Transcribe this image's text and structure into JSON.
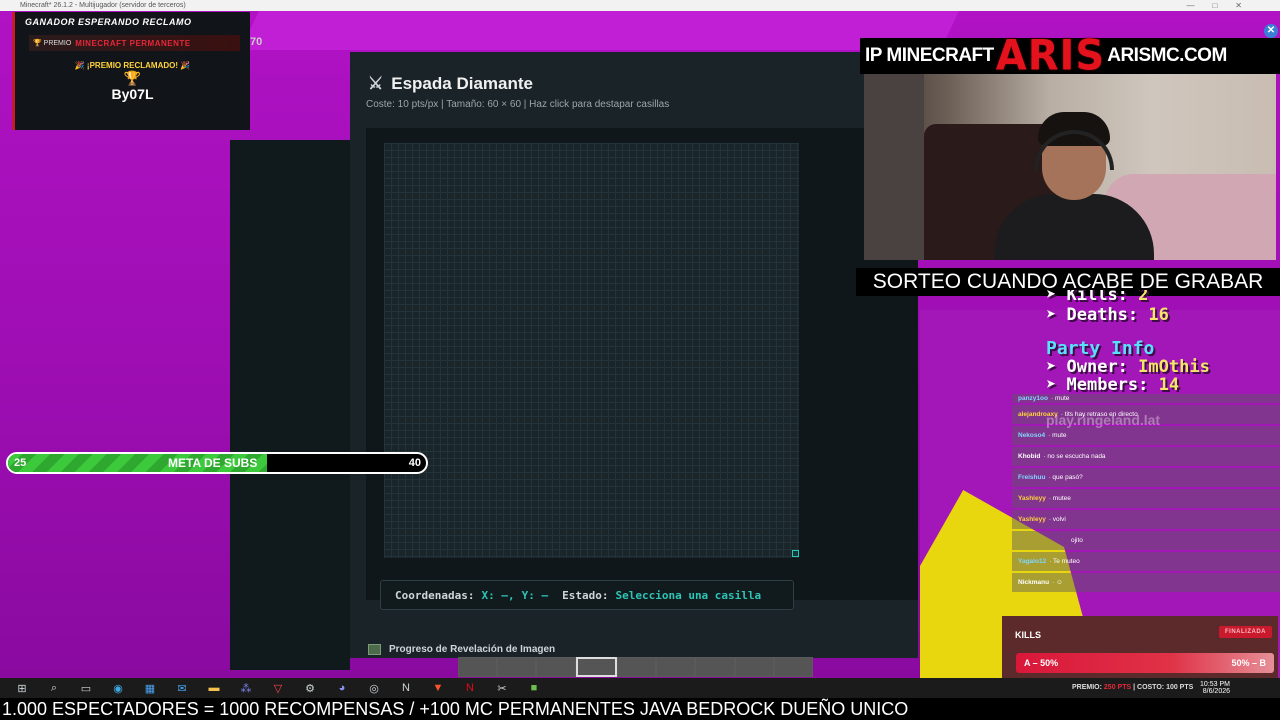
{
  "window": {
    "title": "Minecraft* 26.1.2 - Multijugador (servidor de terceros)",
    "controls": [
      "—",
      "□",
      "✕"
    ]
  },
  "winner": {
    "header": "GANADOR ESPERANDO RECLAMO",
    "prize_label": "🏆 PREMIO",
    "prize_value": "MINECRAFT PERMANENTE",
    "claimed": "🎉 ¡PREMIO RECLAMADO! 🎉",
    "trophy": "🏆",
    "name": "By07L"
  },
  "coords_partial": "70",
  "modal": {
    "title_icon": "⚔",
    "title": "Espada Diamante",
    "subtitle": "Coste: 10 pts/px | Tamaño: 60 × 60 | Haz click para destapar casillas",
    "coords_label": "Coordenadas:",
    "x_value": "X: —,",
    "y_value": "Y: —",
    "state_label": "Estado:",
    "state_value": "Selecciona una casilla",
    "progress_title": "Progreso de Revelación de Imagen"
  },
  "ip_banner": {
    "label": "IP MINECRAFT",
    "logo": "ARIS",
    "domain": "ARISMC.COM"
  },
  "sorteo": "SORTEO CUANDO ACABE DE GRABAR",
  "scoreboard": {
    "kills_label": "Kills:",
    "kills_value": "2",
    "deaths_label": "Deaths:",
    "deaths_value": "16",
    "party_title": "Party Info",
    "owner_label": "Owner:",
    "owner_value": "ImOthis",
    "members_label": "Members:",
    "members_value": "14",
    "arrow": "➤"
  },
  "chat": {
    "watermark": "play.ringeland.lat",
    "messages": [
      {
        "user": "panzy1oo",
        "text": "· mute",
        "color": "#7fd6ff"
      },
      {
        "user": "alejandroaxy",
        "text": "· tits hay retraso en directo",
        "color": "#ffd43a"
      },
      {
        "user": "Nekoso4",
        "text": "· mute",
        "color": "#7fd6ff"
      },
      {
        "user": "Khobid",
        "text": "· no se escucha nada",
        "color": "#ffffff"
      },
      {
        "user": "Freishuu",
        "text": "· que pasó?",
        "color": "#7fd6ff"
      },
      {
        "user": "Yashleyy",
        "text": "· mutee",
        "color": "#ffd43a"
      },
      {
        "user": "Yashleyy",
        "text": "· volvi",
        "color": "#ffd43a"
      },
      {
        "user": "",
        "text": "ojito",
        "color": "#ffffff"
      },
      {
        "user": "Yagalo12",
        "text": "· Te muteo",
        "color": "#7fd6ff"
      },
      {
        "user": "Nickmanu",
        "text": "· ☺",
        "color": "#ffffff"
      }
    ]
  },
  "kills_box": {
    "title": "KILLS",
    "badge": "FINALIZADA",
    "left": "A – 50%",
    "right": "50% – B"
  },
  "subs": {
    "start": "25",
    "label": "META DE SUBS",
    "end": "40",
    "progress": 0.62
  },
  "taskbar": {
    "prize_label": "PREMIO:",
    "prize_value": "250 PTS",
    "cost_label": "| COSTO:",
    "cost_value": "100 PTS",
    "time": "10:53 PM",
    "date": "8/6/2026",
    "icons": [
      "windows-icon",
      "search-icon",
      "taskview-icon",
      "edge-icon",
      "store-icon",
      "mail-icon",
      "folder-icon",
      "teams-icon",
      "valorant-icon",
      "settings-icon",
      "discord-icon",
      "obs-icon",
      "notion-icon",
      "brave-icon",
      "netflix-icon",
      "capcut-icon",
      "minecraft-icon"
    ]
  },
  "ticker": "1.000 ESPECTADORES = 1000 RECOMPENSAS / +100 MC PERMANENTES JAVA BEDROCK DUEÑO UNICO"
}
